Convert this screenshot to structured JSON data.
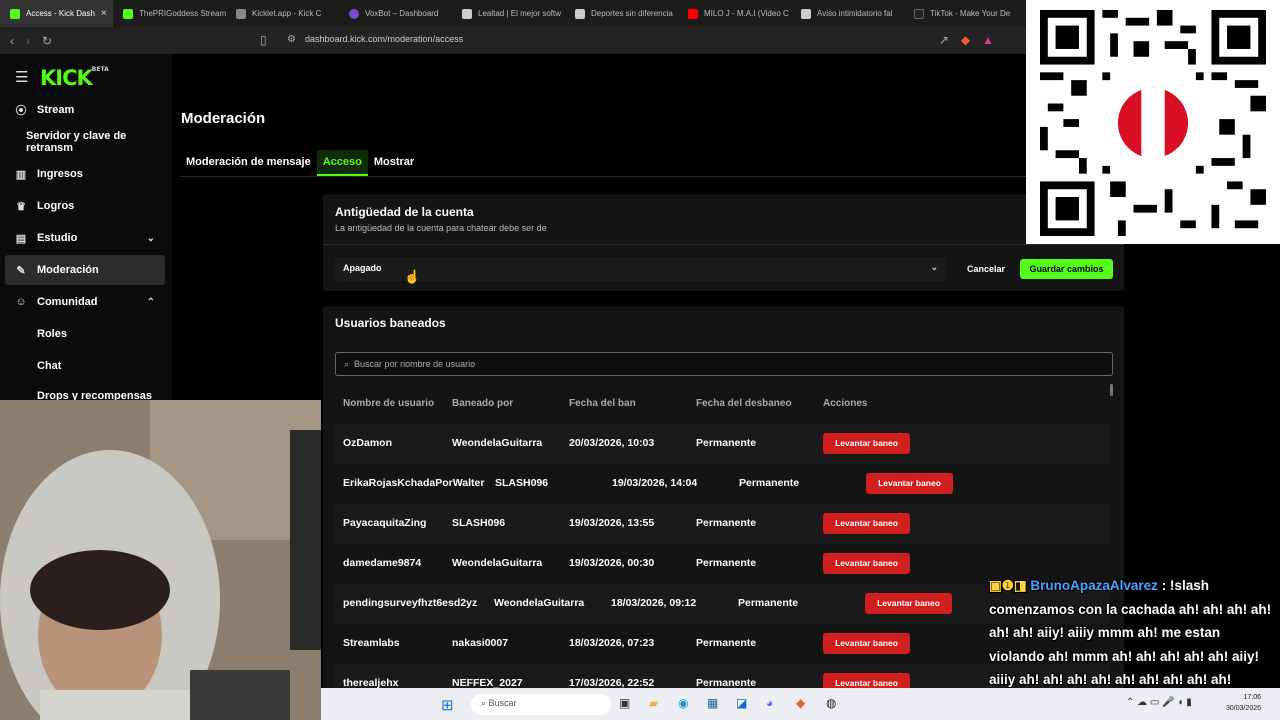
{
  "browser": {
    "tabs": [
      {
        "label": "Access - Kick Dash",
        "color": "#53fc18",
        "active": true
      },
      {
        "label": "ThePRIGoddess Stream",
        "color": "#53fc18"
      },
      {
        "label": "Kicklet.app - Kick C",
        "color": "#888888"
      },
      {
        "label": "VoxBot – Dashboard",
        "color": "#7b4ad1"
      },
      {
        "label": "Lealtad | El mejor softw",
        "color": "#cccccc"
      },
      {
        "label": "Deportes sin diferencia",
        "color": "#cccccc"
      },
      {
        "label": "MILO J - M.A.I (Video C",
        "color": "#ff0000"
      },
      {
        "label": "Aviso intimidatorio fal",
        "color": "#cccccc"
      },
      {
        "label": "TikTok - Make Your De",
        "color": "#222222"
      }
    ],
    "url": "dashboard.kick.com/moderation/access"
  },
  "sidebar": {
    "logo": "KICK",
    "logo_badge": "BETA",
    "items": [
      {
        "label": "Stream",
        "icon": "broadcast-icon"
      },
      {
        "label": "Servidor y clave de retransm"
      },
      {
        "label": "Ingresos",
        "icon": "chart-icon"
      },
      {
        "label": "Logros",
        "icon": "trophy-icon"
      },
      {
        "label": "Estudio",
        "icon": "studio-icon"
      },
      {
        "label": "Moderación",
        "icon": "wrench-icon"
      },
      {
        "label": "Comunidad",
        "icon": "people-icon"
      },
      {
        "label": "Roles"
      },
      {
        "label": "Chat"
      },
      {
        "label": "Drops y recompensas"
      }
    ]
  },
  "page": {
    "title": "Moderación",
    "tabs": [
      "Moderación de mensaje",
      "Acceso",
      "Mostrar"
    ]
  },
  "account_age": {
    "title": "Antigüedad de la cuenta",
    "description": "La antigüedad de la cuenta para chatear debe ser de",
    "selected": "Apagado",
    "cancel_label": "Cancelar",
    "save_label": "Guardar cambios"
  },
  "banned": {
    "title": "Usuarios baneados",
    "search_placeholder": "Buscar por nombre de usuario",
    "columns": [
      "Nombre de usuario",
      "Baneado por",
      "Fecha del ban",
      "Fecha del desbaneo",
      "Acciones"
    ],
    "rows": [
      {
        "user": "OzDamon",
        "by": "WeondelaGuitarra",
        "date": "20/03/2026, 10:03",
        "until": "Permanente",
        "action": "Levantar baneo"
      },
      {
        "user": "ErikaRojasKchadaPorWalter",
        "by": "SLASH096",
        "date": "19/03/2026, 14:04",
        "until": "Permanente",
        "action": "Levantar baneo"
      },
      {
        "user": "PayacaquitaZing",
        "by": "SLASH096",
        "date": "19/03/2026, 13:55",
        "until": "Permanente",
        "action": "Levantar baneo"
      },
      {
        "user": "damedame9874",
        "by": "WeondelaGuitarra",
        "date": "19/03/2026, 00:30",
        "until": "Permanente",
        "action": "Levantar baneo"
      },
      {
        "user": "pendingsurveyfhzt6esd2yz",
        "by": "WeondelaGuitarra",
        "date": "18/03/2026, 09:12",
        "until": "Permanente",
        "action": "Levantar baneo"
      },
      {
        "user": "Streamlabs",
        "by": "nakasi0007",
        "date": "18/03/2026, 07:23",
        "until": "Permanente",
        "action": "Levantar baneo"
      },
      {
        "user": "therealjehx",
        "by": "NEFFEX_2027",
        "date": "17/03/2026, 22:52",
        "until": "Permanente",
        "action": "Levantar baneo"
      }
    ]
  },
  "taskbar": {
    "search": "Buscar",
    "time": "17:06",
    "date": "30/03/2026"
  },
  "overlay_chat": {
    "user": "BrunoApazaAlvarez",
    "message": ": !slash comenzamos con la cachada ah! ah! ah! ah! ah! ah! aiiy! aiiiy mmm ah! me estan violando ah! mmm ah! ah! ah! ah! ah! aiiy! aiiiy ah! ah! ah! ah! ah! ah! ah! ah! ah!"
  },
  "colors": {
    "accent": "#53fc18",
    "danger": "#d11e1e"
  }
}
